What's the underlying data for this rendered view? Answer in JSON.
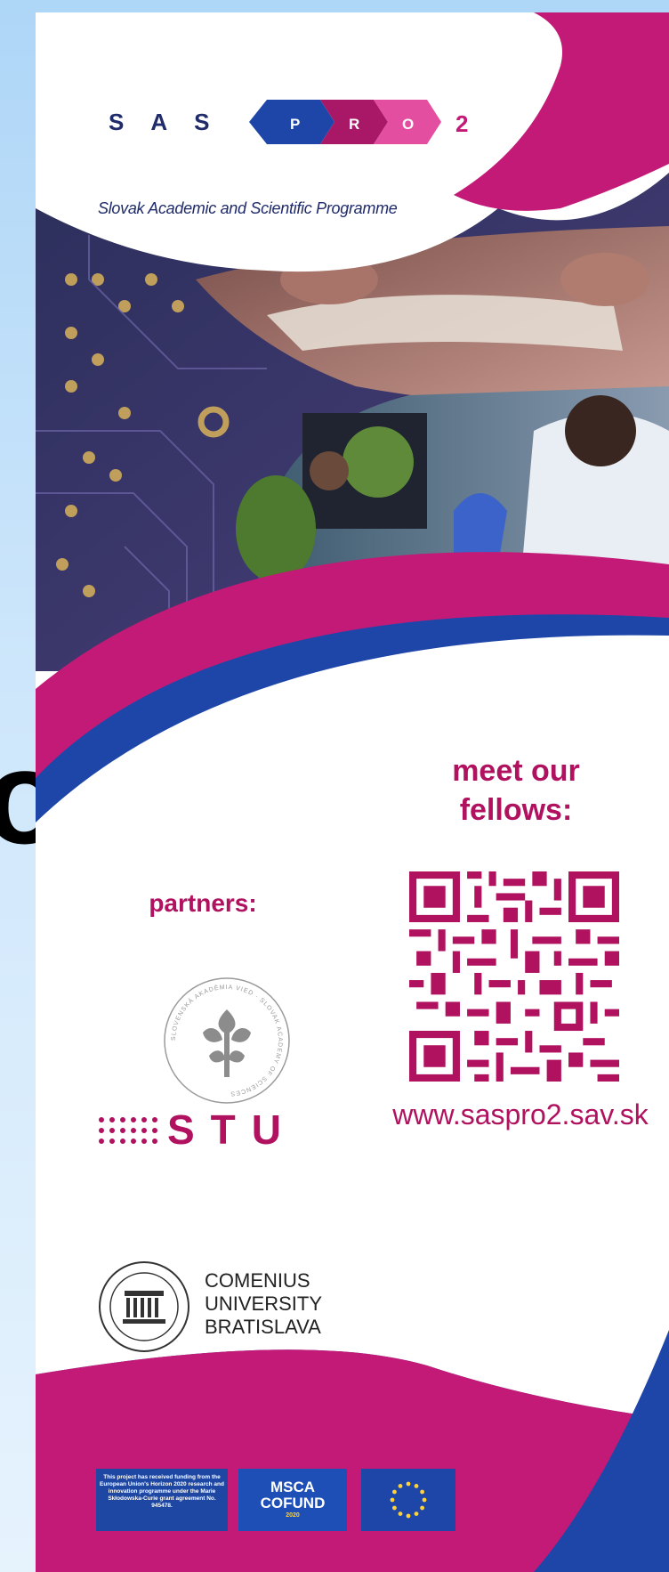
{
  "edge_text": "o",
  "header": {
    "logo_letters": "SAS",
    "logo_chevrons": [
      "P",
      "R",
      "O"
    ],
    "logo_suffix": "2",
    "tagline": "Slovak Academic and Scientific Programme"
  },
  "fellows": {
    "heading_line1": "meet our",
    "heading_line2": "fellows:",
    "website": "www.saspro2.sav.sk"
  },
  "partners": {
    "heading": "partners:",
    "sas_seal_text": "SLOVENSKÁ AKADÉMIA VIED · SLOVAK ACADEMY OF SCIENCES",
    "stu": "STU",
    "comenius_line1": "COMENIUS",
    "comenius_line2": "UNIVERSITY",
    "comenius_line3": "BRATISLAVA"
  },
  "footer": {
    "funding_note": "This project has received funding from the European Union's Horizon 2020 research and innovation programme under the Marie Skłodowska-Curie grant agreement No. 945478.",
    "msca_line1": "MSCA",
    "msca_line2": "COFUND",
    "msca_line3": "2020"
  },
  "colors": {
    "magenta": "#c41a77",
    "dark_magenta": "#b0125f",
    "navy": "#1f2b6b",
    "blue": "#1e46a8",
    "sky": "#aed6f7"
  }
}
